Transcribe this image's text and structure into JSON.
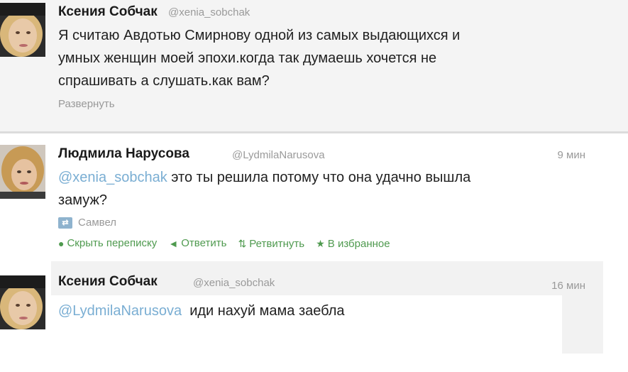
{
  "tweets": [
    {
      "name": "Ксения Собчак",
      "handle": "@xenia_sobchak",
      "lines": [
        "Я считаю Авдотью Смирнову одной из самых выдающихся и",
        "умных женщин моей эпохи.когда так думаешь хочется не",
        "спрашивать а слушать.как вам?"
      ],
      "expand": "Развернуть"
    },
    {
      "name": "Людмила Нарусова",
      "handle": "@LydmilaNarusova",
      "time": "9 мин",
      "mention": "@xenia_sobchak",
      "line1_rest": " это ты решила потому что она удачно вышла",
      "line2": "замуж?",
      "retweeted_by": "Самвел",
      "actions": {
        "hide": "Скрыть переписку",
        "reply": "Ответить",
        "retweet": "Ретвитнуть",
        "favorite": "В избранное"
      }
    },
    {
      "name": "Ксения Собчак",
      "handle": "@xenia_sobchak",
      "time": "16 мин",
      "mention": "@LydmilaNarusova",
      "text_rest": "  иди нахуй мама заебла"
    }
  ],
  "icons": {
    "retweet_badge": "retweet-badge-icon",
    "hide": "speech-bubble-icon",
    "reply": "reply-arrow-icon",
    "retweet": "retweet-icon",
    "favorite": "star-icon"
  },
  "colors": {
    "mention": "#7aaed3",
    "action": "#4f9a4f",
    "meta": "#999999"
  }
}
